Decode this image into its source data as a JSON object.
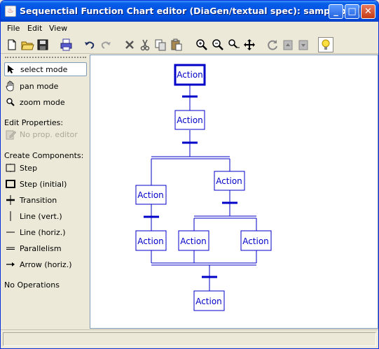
{
  "window": {
    "title": "Sequenctial Function Chart editor (DiaGen/textual spec): sample.xml",
    "minimize": "_",
    "maximize": "□",
    "close": "✕"
  },
  "menu": {
    "items": [
      "File",
      "Edit",
      "View"
    ]
  },
  "toolbar": {
    "icons": [
      "new-icon",
      "open-icon",
      "save-icon",
      "print-icon",
      "undo-icon",
      "redo-icon",
      "delete-icon",
      "cut-icon",
      "copy-icon",
      "paste-icon",
      "zoom-in-icon",
      "zoom-out-icon",
      "zoom-fit-icon",
      "move-icon",
      "refresh-icon",
      "back-icon",
      "forward-icon",
      "hint-bulb-icon"
    ]
  },
  "sidebar": {
    "modes": [
      {
        "label": "select mode",
        "icon": "arrow-cursor-icon",
        "selected": true
      },
      {
        "label": "pan mode",
        "icon": "hand-icon",
        "selected": false
      },
      {
        "label": "zoom mode",
        "icon": "magnifier-icon",
        "selected": false
      }
    ],
    "edit_properties_heading": "Edit Properties:",
    "prop_editor_label": "No prop. editor",
    "create_components_heading": "Create Components:",
    "components": [
      {
        "label": "Step",
        "icon": "step-icon"
      },
      {
        "label": "Step (initial)",
        "icon": "initial-step-icon"
      },
      {
        "label": "Transition",
        "icon": "transition-icon"
      },
      {
        "label": "Line (vert.)",
        "icon": "vertical-line-icon"
      },
      {
        "label": "Line (horiz.)",
        "icon": "horizontal-line-icon"
      },
      {
        "label": "Parallelism",
        "icon": "parallelism-icon"
      },
      {
        "label": "Arrow (horiz.)",
        "icon": "arrow-icon"
      }
    ],
    "operations_label": "No Operations"
  },
  "diagram": {
    "step_label": "Action",
    "steps": [
      "Action",
      "Action",
      "Action",
      "Action",
      "Action",
      "Action",
      "Action",
      "Action"
    ],
    "accent": "#0000c8"
  },
  "status": {
    "text": ""
  }
}
